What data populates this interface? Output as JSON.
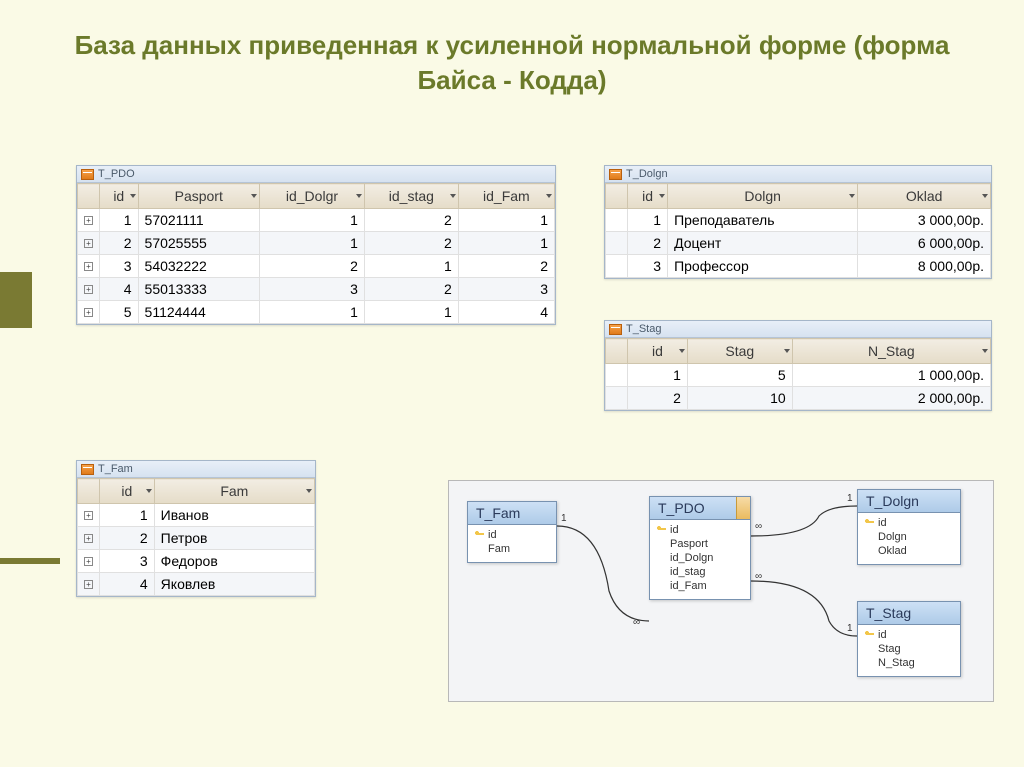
{
  "title": "База данных приведенная к усиленной нормальной форме  (форма Байса - Кодда)",
  "tables": {
    "pdo": {
      "name": "T_PDO",
      "headers": [
        "id",
        "Pasport",
        "id_Dolgr",
        "id_stag",
        "id_Fam"
      ],
      "rows": [
        [
          "1",
          "57021111",
          "1",
          "2",
          "1"
        ],
        [
          "2",
          "57025555",
          "1",
          "2",
          "1"
        ],
        [
          "3",
          "54032222",
          "2",
          "1",
          "2"
        ],
        [
          "4",
          "55013333",
          "3",
          "2",
          "3"
        ],
        [
          "5",
          "51124444",
          "1",
          "1",
          "4"
        ]
      ]
    },
    "dolgn": {
      "name": "T_Dolgn",
      "headers": [
        "id",
        "Dolgn",
        "Oklad"
      ],
      "rows": [
        [
          "1",
          "Преподаватель",
          "3 000,00р."
        ],
        [
          "2",
          "Доцент",
          "6 000,00р."
        ],
        [
          "3",
          "Профессор",
          "8 000,00р."
        ]
      ]
    },
    "stag": {
      "name": "T_Stag",
      "headers": [
        "id",
        "Stag",
        "N_Stag"
      ],
      "rows": [
        [
          "1",
          "5",
          "1 000,00р."
        ],
        [
          "2",
          "10",
          "2 000,00р."
        ]
      ]
    },
    "fam": {
      "name": "T_Fam",
      "headers": [
        "id",
        "Fam"
      ],
      "rows": [
        [
          "1",
          "Иванов"
        ],
        [
          "2",
          "Петров"
        ],
        [
          "3",
          "Федоров"
        ],
        [
          "4",
          "Яковлев"
        ]
      ]
    }
  },
  "diagram": {
    "boxes": {
      "fam": {
        "title": "T_Fam",
        "fields": [
          {
            "name": "id",
            "key": true
          },
          {
            "name": "Fam"
          }
        ]
      },
      "pdo": {
        "title": "T_PDO",
        "fields": [
          {
            "name": "id",
            "key": true
          },
          {
            "name": "Pasport"
          },
          {
            "name": "id_Dolgn"
          },
          {
            "name": "id_stag"
          },
          {
            "name": "id_Fam"
          }
        ]
      },
      "dolgn": {
        "title": "T_Dolgn",
        "fields": [
          {
            "name": "id",
            "key": true
          },
          {
            "name": "Dolgn"
          },
          {
            "name": "Oklad"
          }
        ]
      },
      "stag": {
        "title": "T_Stag",
        "fields": [
          {
            "name": "id",
            "key": true
          },
          {
            "name": "Stag"
          },
          {
            "name": "N_Stag"
          }
        ]
      }
    },
    "labels": {
      "one": "1",
      "many": "∞"
    }
  }
}
